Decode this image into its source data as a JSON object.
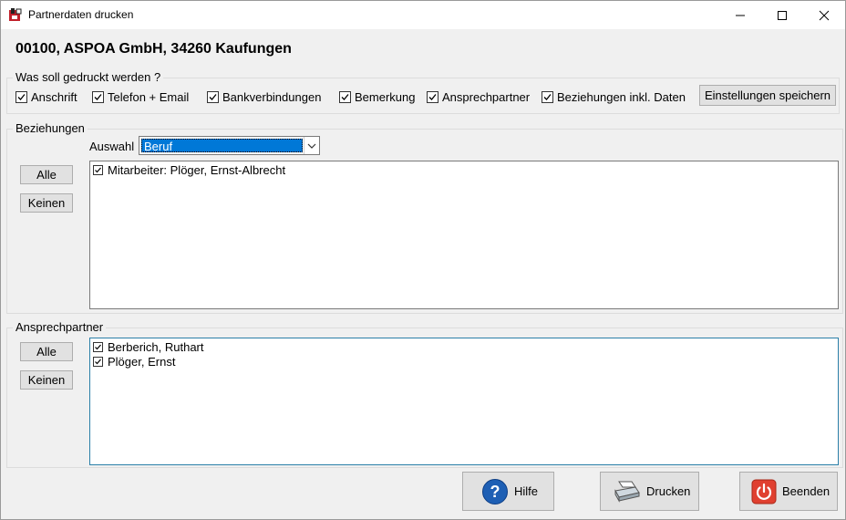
{
  "window": {
    "title": "Partnerdaten drucken",
    "icon": "app-icon"
  },
  "header": {
    "title": "00100, ASPOA GmbH, 34260  Kaufungen"
  },
  "print_options": {
    "label": "Was soll gedruckt werden ?",
    "items": [
      {
        "label": "Anschrift",
        "checked": true
      },
      {
        "label": "Telefon + Email",
        "checked": true
      },
      {
        "label": "Bankverbindungen",
        "checked": true
      },
      {
        "label": "Bemerkung",
        "checked": true
      },
      {
        "label": "Ansprechpartner",
        "checked": true
      },
      {
        "label": "Beziehungen inkl. Daten",
        "checked": true
      }
    ],
    "save_label": "Einstellungen speichern"
  },
  "beziehungen": {
    "label": "Beziehungen",
    "auswahl_label": "Auswahl",
    "auswahl_value": "Beruf",
    "all_label": "Alle",
    "none_label": "Keinen",
    "items": [
      {
        "label": "Mitarbeiter: Plöger, Ernst-Albrecht",
        "checked": true
      }
    ]
  },
  "ansprechpartner": {
    "label": "Ansprechpartner",
    "all_label": "Alle",
    "none_label": "Keinen",
    "items": [
      {
        "label": "Berberich, Ruthart",
        "checked": true
      },
      {
        "label": "Plöger, Ernst",
        "checked": true
      }
    ]
  },
  "footer": {
    "help_label": "Hilfe",
    "print_label": "Drucken",
    "exit_label": "Beenden"
  },
  "colors": {
    "accent": "#0078d7",
    "help_icon": "#1e5fb4",
    "exit_icon": "#e04030"
  }
}
